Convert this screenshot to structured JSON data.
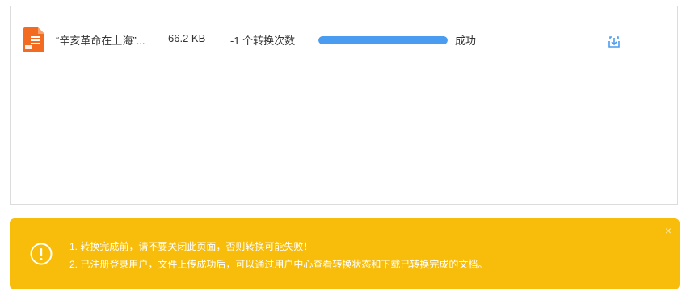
{
  "file_list": {
    "items": [
      {
        "icon": "document-file-icon",
        "name": "“辛亥革命在上海”...",
        "size": "66.2 KB",
        "convert_count": "-1 个转换次数",
        "progress": 1.0,
        "status": "成功",
        "download_icon": "download-icon"
      }
    ]
  },
  "notice": {
    "icon": "exclamation-circle-icon",
    "lines": [
      "1. 转换完成前，请不要关闭此页面，否则转换可能失败！",
      "2. 已注册登录用户，文件上传成功后，可以通过用户中心查看转换状态和下载已转换完成的文档。"
    ],
    "close_label": "×",
    "close_icon": "close-icon"
  },
  "colors": {
    "accent": "#4a9cf0",
    "notice_bg": "#f8bd0a",
    "file_icon": "#f26b21"
  }
}
